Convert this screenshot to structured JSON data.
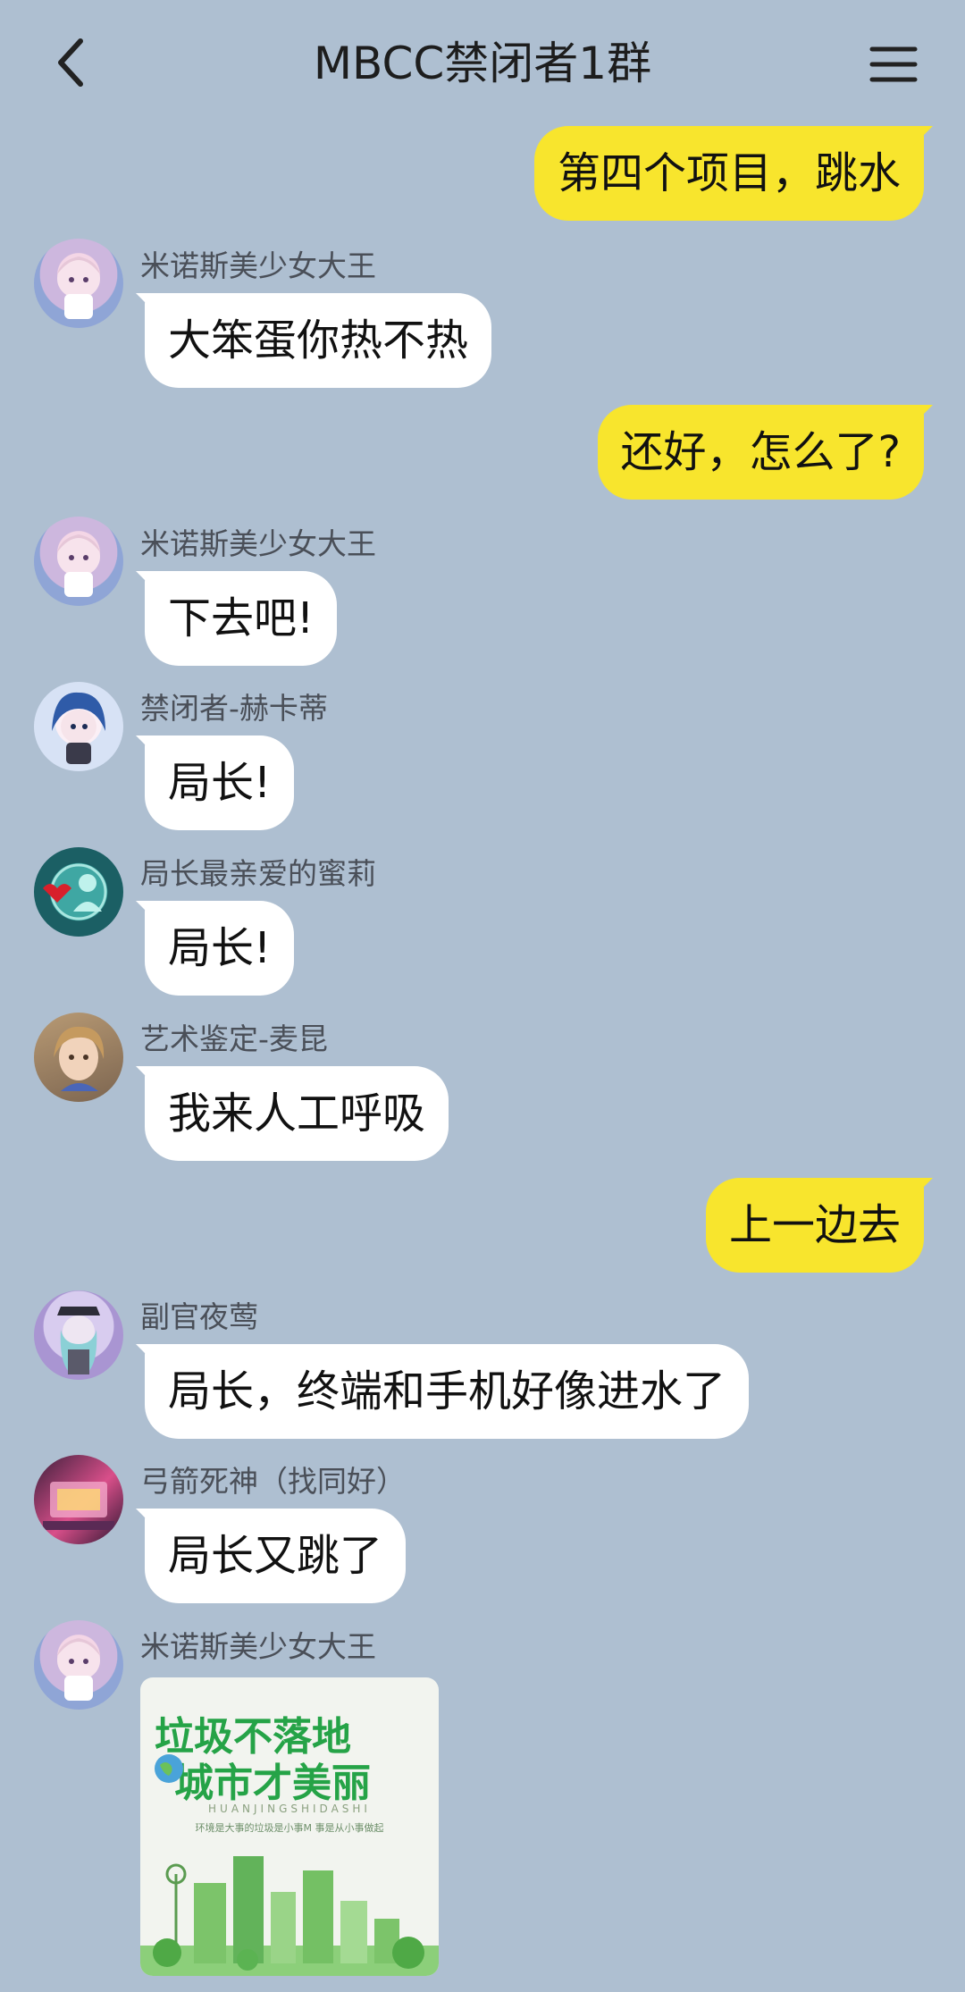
{
  "header": {
    "title": "MBCC禁闭者1群",
    "back_icon": "chevron-left-icon",
    "menu_icon": "hamburger-menu-icon"
  },
  "messages": [
    {
      "side": "out",
      "text": "第四个项目，跳水"
    },
    {
      "side": "in",
      "sender": "米诺斯美少女大王",
      "text": "大笨蛋你热不热"
    },
    {
      "side": "out",
      "text": "还好，怎么了?"
    },
    {
      "side": "in",
      "sender": "米诺斯美少女大王",
      "text": "下去吧!"
    },
    {
      "side": "in",
      "sender": "禁闭者-赫卡蒂",
      "text": "局长!"
    },
    {
      "side": "in",
      "sender": "局长最亲爱的蜜莉",
      "text": "局长!"
    },
    {
      "side": "in",
      "sender": "艺术鉴定-麦昆",
      "text": "我来人工呼吸"
    },
    {
      "side": "out",
      "text": "上一边去"
    },
    {
      "side": "in",
      "sender": "副官夜莺",
      "text": "局长，终端和手机好像进水了"
    },
    {
      "side": "in",
      "sender": "弓箭死神（找同好）",
      "text": "局长又跳了"
    },
    {
      "side": "in",
      "sender": "米诺斯美少女大王",
      "image": {
        "line1": "垃圾不落地",
        "line2": "城市才美丽",
        "sub": "HUANJINGSHIDASHI",
        "sub2": "环境是大事的垃圾是小事M 事是从小事做起"
      }
    }
  ],
  "colors": {
    "background": "#aebfd1",
    "outgoing_bubble": "#f8e52d",
    "incoming_bubble": "#ffffff"
  }
}
